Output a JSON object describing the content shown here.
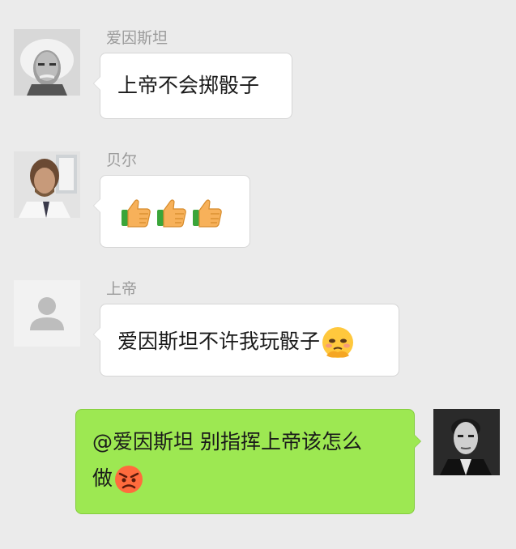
{
  "chat": {
    "messages": [
      {
        "sender": "爱因斯坦",
        "text": "上帝不会掷骰子",
        "avatar_icon": "einstein-portrait"
      },
      {
        "sender": "贝尔",
        "emoji": [
          "thumbs-up",
          "thumbs-up",
          "thumbs-up"
        ],
        "avatar_icon": "bell-portrait"
      },
      {
        "sender": "上帝",
        "text": "爱因斯坦不许我玩骰子",
        "trailing_emoji": "pleading-face",
        "avatar_icon": "default-user-silhouette"
      },
      {
        "sender": "",
        "text_line1": "@爱因斯坦 别指挥上帝该怎么",
        "text_line2": "做",
        "trailing_emoji": "angry-face",
        "avatar_icon": "bohr-portrait",
        "outgoing": true
      }
    ]
  },
  "colors": {
    "background": "#ebebeb",
    "incoming_bubble": "#ffffff",
    "outgoing_bubble": "#9de852",
    "sender_name": "#9a9a9a"
  }
}
